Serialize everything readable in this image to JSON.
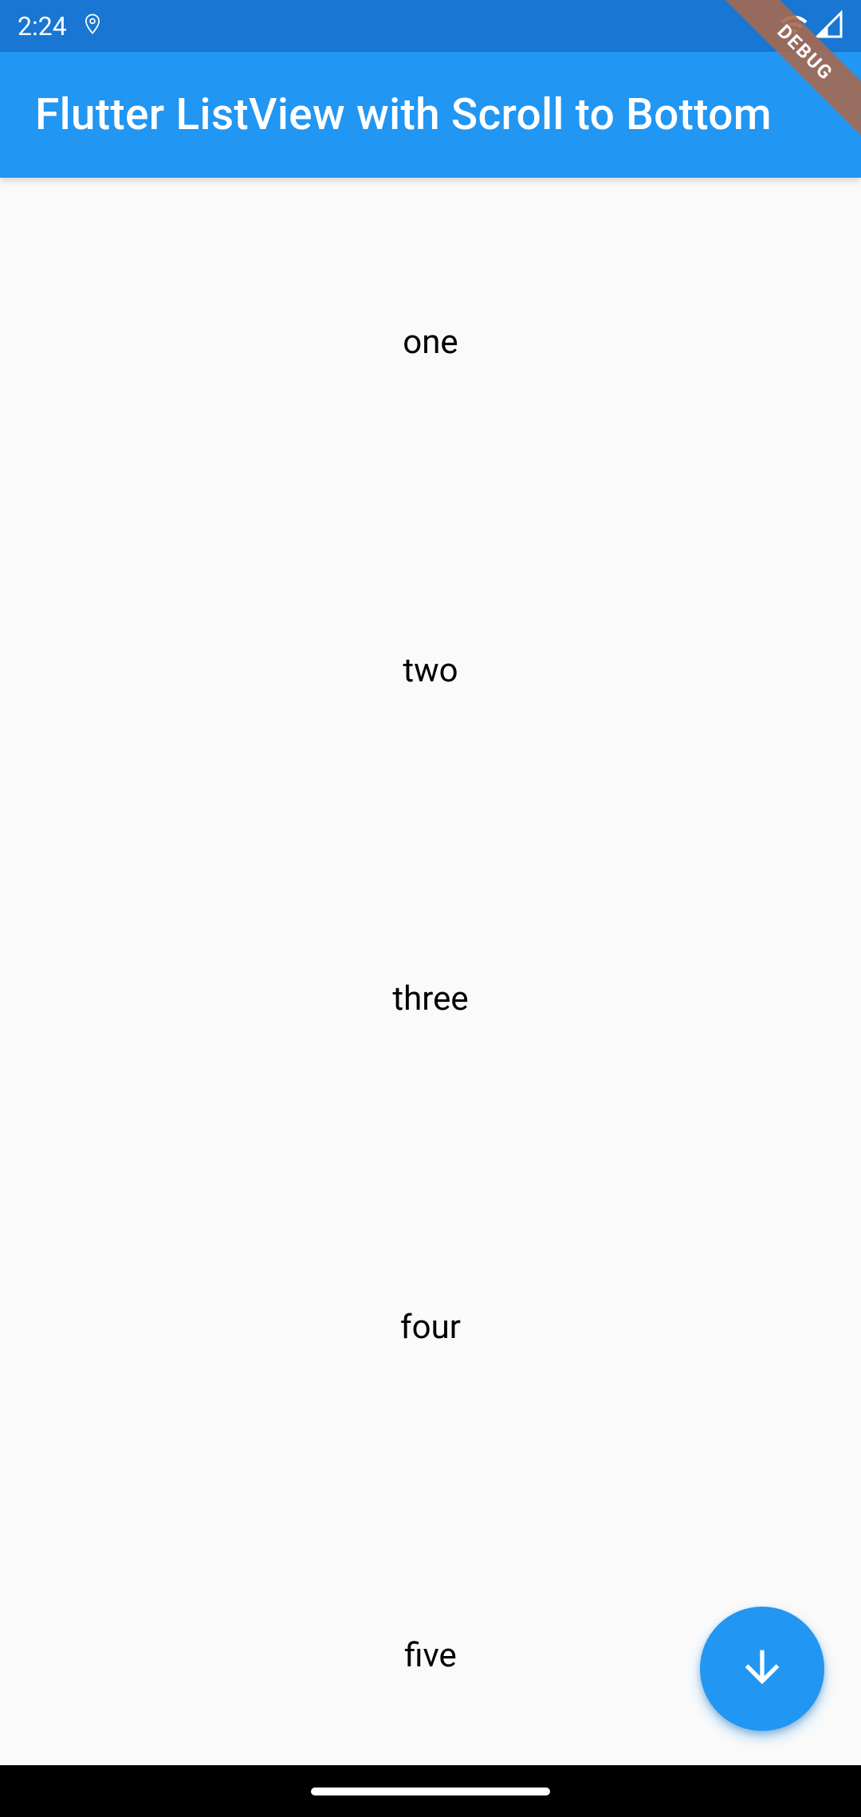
{
  "status_bar": {
    "time": "2:24",
    "debug_label": "DEBUG"
  },
  "app_bar": {
    "title": "Flutter ListView with Scroll to Bottom"
  },
  "list": {
    "items": [
      "one",
      "two",
      "three",
      "four",
      "five"
    ]
  },
  "colors": {
    "primary": "#2196F3",
    "primary_dark": "#1976D2",
    "background": "#fafafa"
  }
}
